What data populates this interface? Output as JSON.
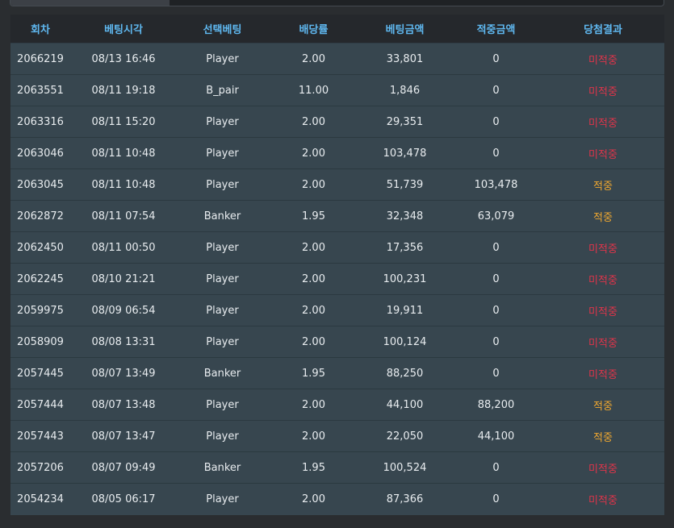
{
  "table": {
    "headers": [
      "회차",
      "베팅시각",
      "선택베팅",
      "배당률",
      "베팅금액",
      "적중금액",
      "당첨결과"
    ],
    "rows": [
      [
        "2066219",
        "08/13 16:46",
        "Player",
        "2.00",
        "33,801",
        "0",
        "미적중"
      ],
      [
        "2063551",
        "08/11 19:18",
        "B_pair",
        "11.00",
        "1,846",
        "0",
        "미적중"
      ],
      [
        "2063316",
        "08/11 15:20",
        "Player",
        "2.00",
        "29,351",
        "0",
        "미적중"
      ],
      [
        "2063046",
        "08/11 10:48",
        "Player",
        "2.00",
        "103,478",
        "0",
        "미적중"
      ],
      [
        "2063045",
        "08/11 10:48",
        "Player",
        "2.00",
        "51,739",
        "103,478",
        "적중"
      ],
      [
        "2062872",
        "08/11 07:54",
        "Banker",
        "1.95",
        "32,348",
        "63,079",
        "적중"
      ],
      [
        "2062450",
        "08/11 00:50",
        "Player",
        "2.00",
        "17,356",
        "0",
        "미적중"
      ],
      [
        "2062245",
        "08/10 21:21",
        "Player",
        "2.00",
        "100,231",
        "0",
        "미적중"
      ],
      [
        "2059975",
        "08/09 06:54",
        "Player",
        "2.00",
        "19,911",
        "0",
        "미적중"
      ],
      [
        "2058909",
        "08/08 13:31",
        "Player",
        "2.00",
        "100,124",
        "0",
        "미적중"
      ],
      [
        "2057445",
        "08/07 13:49",
        "Banker",
        "1.95",
        "88,250",
        "0",
        "미적중"
      ],
      [
        "2057444",
        "08/07 13:48",
        "Player",
        "2.00",
        "44,100",
        "88,200",
        "적중"
      ],
      [
        "2057443",
        "08/07 13:47",
        "Player",
        "2.00",
        "22,050",
        "44,100",
        "적중"
      ],
      [
        "2057206",
        "08/07 09:49",
        "Banker",
        "1.95",
        "100,524",
        "0",
        "미적중"
      ],
      [
        "2054234",
        "08/05 06:17",
        "Player",
        "2.00",
        "87,366",
        "0",
        "미적중"
      ]
    ],
    "result_hit_label": "적중",
    "colors": {
      "header_text": "#5fb8f0",
      "header_bg": "#25282c",
      "row_bg": "#37464f",
      "miss": "#e0344a",
      "hit": "#f0a830"
    }
  }
}
